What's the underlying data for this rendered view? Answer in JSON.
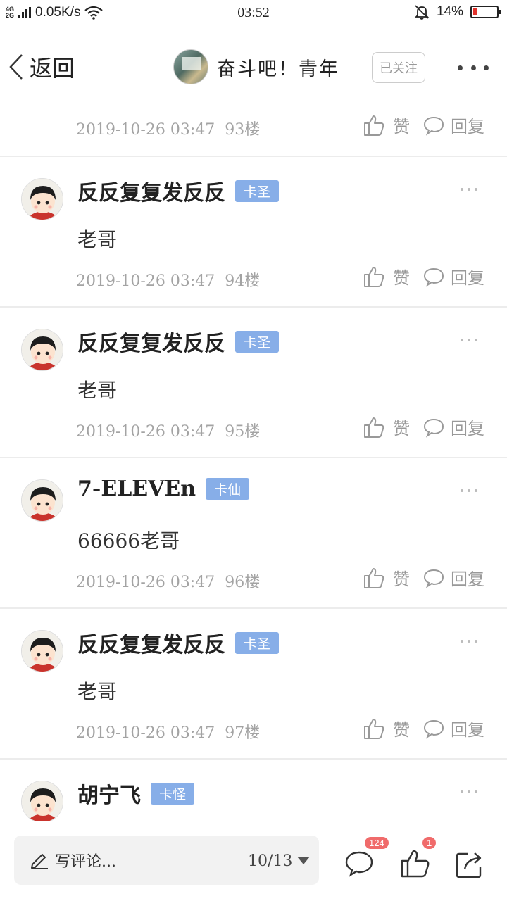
{
  "status_bar": {
    "network_top": "4G",
    "network_bottom": "2G",
    "speed": "0.05K/s",
    "time": "03:52",
    "battery_percent": "14%",
    "battery_level": 0.14,
    "battery_color": "#e2332c",
    "icons": [
      "signal-icon",
      "wifi-icon",
      "bell-muted-icon",
      "battery-icon"
    ]
  },
  "nav": {
    "back_label": "返回",
    "forum_name": "奋斗吧！青年",
    "follow_label": "已关注"
  },
  "first_floor_meta": {
    "time": "2019-10-26 03:47",
    "floor": "93楼",
    "like_label": "赞",
    "reply_label": "回复"
  },
  "posts": [
    {
      "author": "反反复复发反反",
      "badge": "卡圣",
      "content": "老哥",
      "time": "2019-10-26 03:47",
      "floor": "94楼",
      "like_label": "赞",
      "reply_label": "回复"
    },
    {
      "author": "反反复复发反反",
      "badge": "卡圣",
      "content": "老哥",
      "time": "2019-10-26 03:47",
      "floor": "95楼",
      "like_label": "赞",
      "reply_label": "回复"
    },
    {
      "author": "7-ELEVEn",
      "badge": "卡仙",
      "content": "66666老哥",
      "time": "2019-10-26 03:47",
      "floor": "96楼",
      "like_label": "赞",
      "reply_label": "回复"
    },
    {
      "author": "反反复复发反反",
      "badge": "卡圣",
      "content": "老哥",
      "time": "2019-10-26 03:47",
      "floor": "97楼",
      "like_label": "赞",
      "reply_label": "回复"
    },
    {
      "author": "胡宁飞",
      "badge": "卡怪"
    }
  ],
  "bottom_bar": {
    "comment_placeholder": "写评论...",
    "page_indicator": "10/13",
    "comment_count": "124",
    "like_count": "1"
  },
  "colors": {
    "badge": "#87aee8",
    "count_badge": "#f06b6b",
    "meta_text": "#a3a3a3"
  }
}
